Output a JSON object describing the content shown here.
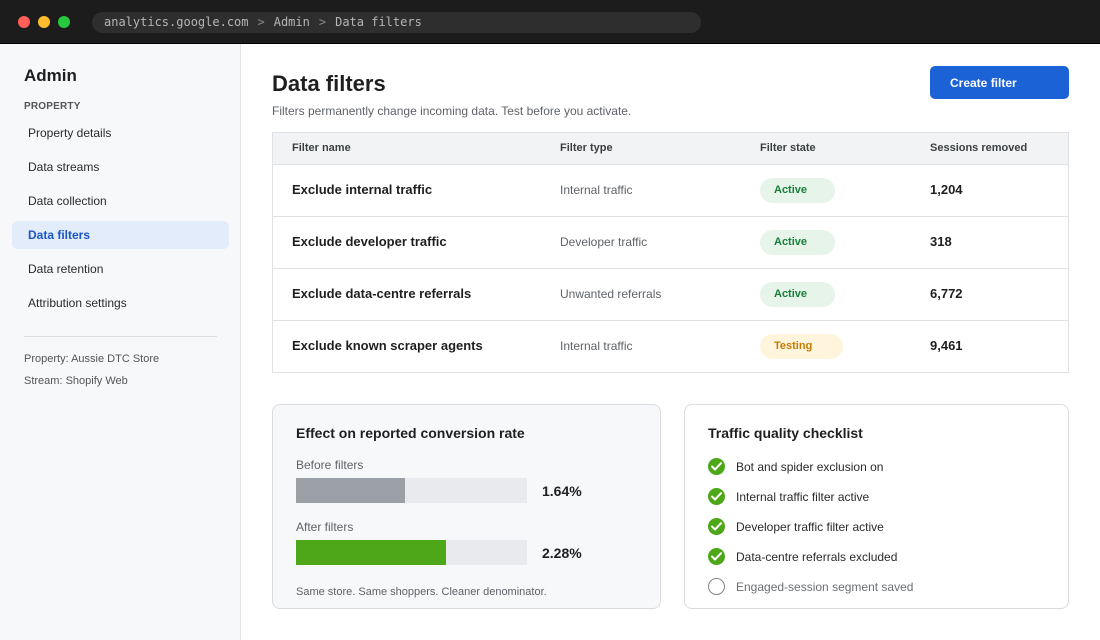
{
  "window": {
    "url_parts": [
      "analytics.google.com",
      "Admin",
      "Data filters"
    ],
    "url_separator": ">"
  },
  "sidebar": {
    "title": "Admin",
    "section": "PROPERTY",
    "items": [
      {
        "label": "Property details",
        "active": false
      },
      {
        "label": "Data streams",
        "active": false
      },
      {
        "label": "Data collection",
        "active": false
      },
      {
        "label": "Data filters",
        "active": true
      },
      {
        "label": "Data retention",
        "active": false
      },
      {
        "label": "Attribution settings",
        "active": false
      }
    ],
    "meta": [
      "Property: Aussie DTC Store",
      "Stream: Shopify Web"
    ]
  },
  "main": {
    "title": "Data filters",
    "subtitle": "Filters permanently change incoming data. Test before you activate.",
    "create_button": "Create filter",
    "table": {
      "headers": [
        "Filter name",
        "Filter type",
        "Filter state",
        "Sessions removed"
      ],
      "rows": [
        {
          "name": "Exclude internal traffic",
          "type": "Internal traffic",
          "state": "Active",
          "sessions": "1,204"
        },
        {
          "name": "Exclude developer traffic",
          "type": "Developer traffic",
          "state": "Active",
          "sessions": "318"
        },
        {
          "name": "Exclude data-centre referrals",
          "type": "Unwanted referrals",
          "state": "Active",
          "sessions": "6,772"
        },
        {
          "name": "Exclude known scraper agents",
          "type": "Internal traffic",
          "state": "Testing",
          "sessions": "9,461"
        }
      ]
    },
    "effect_card": {
      "title": "Effect on reported conversion rate",
      "before": {
        "label": "Before filters",
        "value": "1.64%",
        "fill_fraction": 0.47
      },
      "after": {
        "label": "After filters",
        "value": "2.28%",
        "fill_fraction": 0.65
      },
      "footnote": "Same store. Same shoppers. Cleaner denominator."
    },
    "checklist_card": {
      "title": "Traffic quality checklist",
      "items": [
        {
          "label": "Bot and spider exclusion on",
          "checked": true
        },
        {
          "label": "Internal traffic filter active",
          "checked": true
        },
        {
          "label": "Developer traffic filter active",
          "checked": true
        },
        {
          "label": "Data-centre referrals excluded",
          "checked": true
        },
        {
          "label": "Engaged-session segment saved",
          "checked": false
        }
      ]
    }
  },
  "colors": {
    "primary": "#1a62d6",
    "active_badge_text": "#188038",
    "testing_badge_text": "#c77b00",
    "after_bar": "#4ea619",
    "before_bar": "#9aa0a6"
  }
}
